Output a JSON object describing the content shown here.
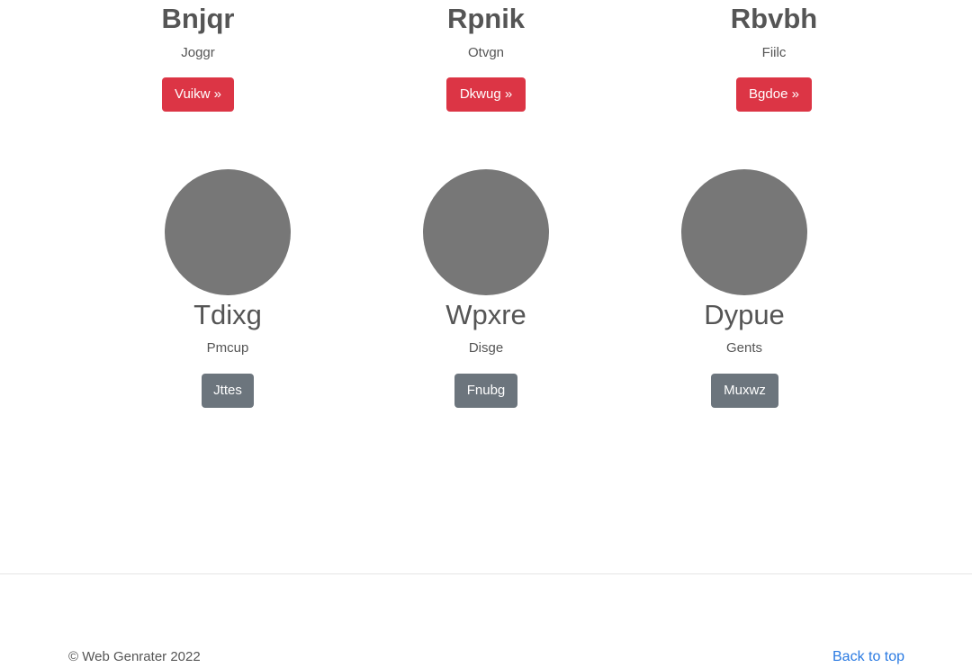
{
  "row1": [
    {
      "title": "Bnjqr",
      "subtitle": "Joggr",
      "button": "Vuikw »"
    },
    {
      "title": "Rpnik",
      "subtitle": "Otvgn",
      "button": "Dkwug »"
    },
    {
      "title": "Rbvbh",
      "subtitle": "Fiilc",
      "button": "Bgdoe »"
    }
  ],
  "row2": [
    {
      "title": "Tdixg",
      "subtitle": "Pmcup",
      "button": "Jttes"
    },
    {
      "title": "Wpxre",
      "subtitle": "Disge",
      "button": "Fnubg"
    },
    {
      "title": "Dypue",
      "subtitle": "Gents",
      "button": "Muxwz"
    }
  ],
  "colors": {
    "danger": "#dc3545",
    "secondary": "#6c757d",
    "placeholder": "#777777",
    "link": "#2a7ae2"
  },
  "footer": {
    "copyright": "© Web Genrater 2022",
    "back_to_top": "Back to top"
  }
}
